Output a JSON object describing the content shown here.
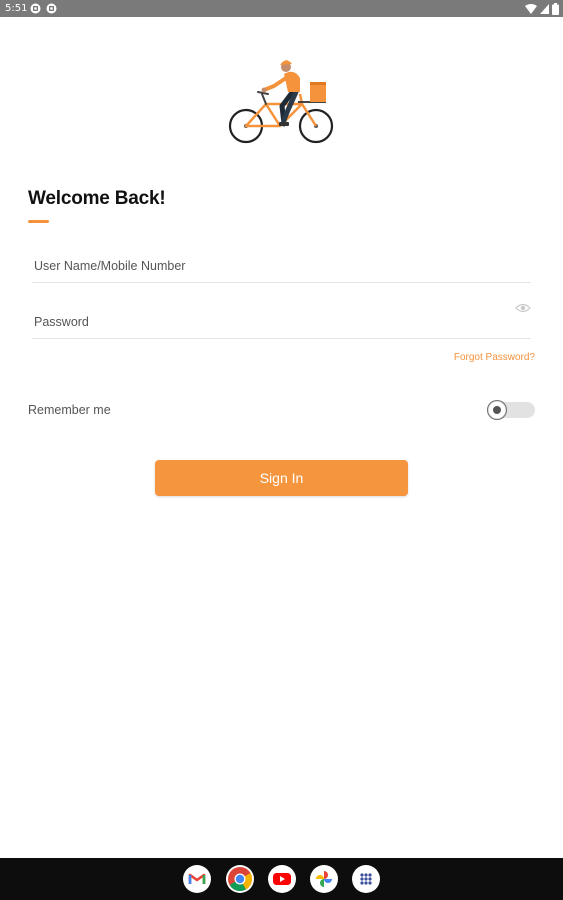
{
  "status_bar": {
    "time": "5:51"
  },
  "login": {
    "title": "Welcome Back!",
    "username_placeholder": "User Name/Mobile Number",
    "password_placeholder": "Password",
    "forgot_password": "Forgot Password?",
    "remember_me": "Remember me",
    "remember_me_on": false,
    "sign_in": "Sign In"
  },
  "colors": {
    "accent": "#f5933d",
    "status_bar": "#7a7a7a",
    "dock": "#0d0d0d"
  },
  "dock": {
    "apps": [
      "gmail-icon",
      "chrome-icon",
      "youtube-icon",
      "photos-icon",
      "app-drawer-icon"
    ]
  }
}
